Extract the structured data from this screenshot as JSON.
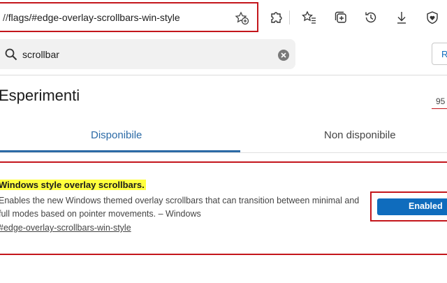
{
  "address_bar": {
    "prefix": "//",
    "path": "flags/#edge-overlay-scrollbars-win-style"
  },
  "icons": {
    "favorite": "add-to-favorites-icon",
    "extensions": "extensions-puzzle-icon",
    "favorites": "favorites-list-icon",
    "collections": "collections-icon",
    "history": "history-icon",
    "downloads": "download-icon",
    "browser_essentials": "browser-essentials-heart-icon"
  },
  "search": {
    "value": "scrollbar",
    "reset_label": "R"
  },
  "page": {
    "title": "Esperimenti",
    "version": "95"
  },
  "tabs": [
    {
      "label": "Disponibile",
      "active": true
    },
    {
      "label": "Non disponibile",
      "active": false
    }
  ],
  "flag": {
    "name": "Windows style overlay scrollbars.",
    "description": "Enables the new Windows themed overlay scrollbars that can transition between minimal and full modes based on pointer movements. – Windows",
    "link": "#edge-overlay-scrollbars-win-style",
    "state": "Enabled"
  },
  "colors": {
    "accent": "#0f6cbd",
    "tab_active": "#2b6aa6",
    "highlight": "#ffff3d",
    "annotation_red": "#c4161c"
  }
}
